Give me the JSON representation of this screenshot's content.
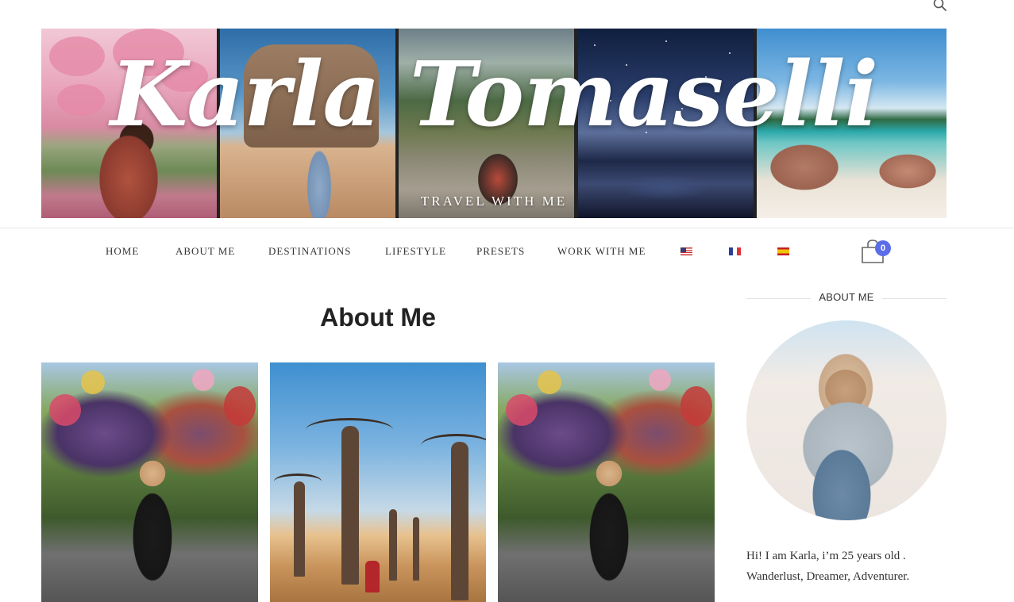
{
  "site": {
    "title": "Karla Tomaselli",
    "tagline": "TRAVEL WITH ME"
  },
  "header": {
    "search_icon": "search-icon"
  },
  "nav": {
    "items": [
      {
        "label": "HOME"
      },
      {
        "label": "ABOUT ME"
      },
      {
        "label": "DESTINATIONS"
      },
      {
        "label": "LIFESTYLE"
      },
      {
        "label": "PRESETS"
      },
      {
        "label": "WORK WITH ME"
      }
    ],
    "languages": [
      {
        "name": "english-flag-icon"
      },
      {
        "name": "french-flag-icon"
      },
      {
        "name": "spanish-flag-icon"
      }
    ],
    "cart_count": "0",
    "accent_color": "#5b6ee8"
  },
  "main": {
    "page_title": "About Me"
  },
  "sidebar": {
    "heading": "ABOUT ME",
    "bio_line1": "Hi! I am Karla, i’m 25 years old .",
    "bio_line2": "Wanderlust, Dreamer, Adventurer."
  }
}
